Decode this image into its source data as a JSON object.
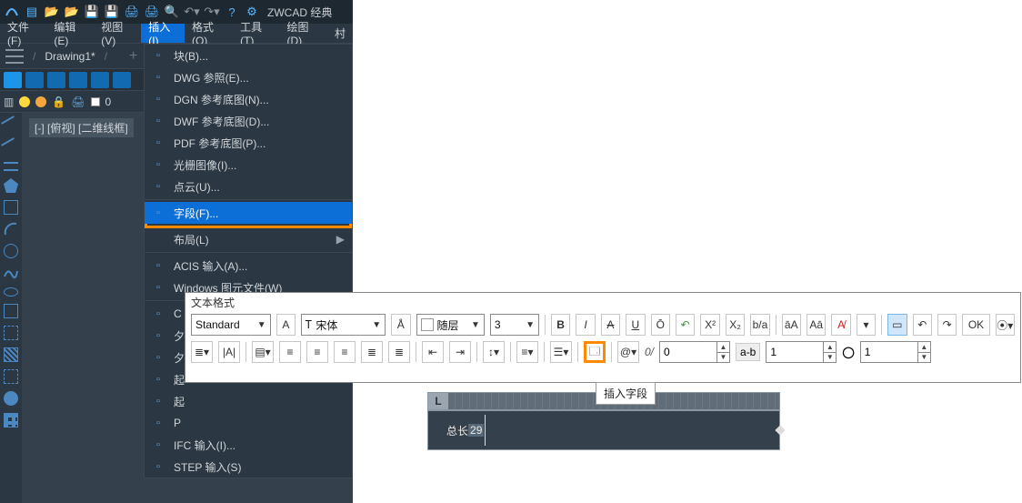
{
  "app_title": "ZWCAD 经典",
  "menubar": {
    "items": [
      "文件(F)",
      "编辑(E)",
      "视图(V)",
      "插入(I)",
      "格式(O)",
      "工具(T)",
      "绘图(D)"
    ],
    "active_index": 3,
    "overflow": "村"
  },
  "document": {
    "tab": "Drawing1*",
    "add_label": "+"
  },
  "viewport_label": "[-] [俯视] [二维线框]",
  "insert_menu": {
    "items": [
      {
        "label": "块(B)...",
        "icon": "block"
      },
      {
        "label": "DWG 参照(E)...",
        "icon": "dwg"
      },
      {
        "label": "DGN 参考底图(N)...",
        "icon": "dgn"
      },
      {
        "label": "DWF 参考底图(D)...",
        "icon": "dwf"
      },
      {
        "label": "PDF 参考底图(P)...",
        "icon": "pdf"
      },
      {
        "label": "光栅图像(I)...",
        "icon": "image"
      },
      {
        "label": "点云(U)...",
        "icon": "cloud"
      },
      {
        "label": "字段(F)...",
        "icon": "field",
        "highlight": true
      },
      {
        "label": "布局(L)",
        "submenu": true,
        "icon": ""
      },
      {
        "label": "ACIS 输入(A)...",
        "icon": "acis"
      },
      {
        "label": "Windows 图元文件(W)",
        "icon": "wmf"
      },
      {
        "label": "C",
        "icon": "obj",
        "truncated": true
      },
      {
        "label": "夕",
        "icon": "ext",
        "truncated": true
      },
      {
        "label": "夕",
        "icon": "ext2",
        "truncated": true
      },
      {
        "label": "起",
        "icon": "hyp",
        "truncated": true
      },
      {
        "label": "起",
        "icon": "map",
        "truncated": true
      },
      {
        "label": "P",
        "icon": "img2",
        "truncated": true
      },
      {
        "label": "IFC 输入(I)...",
        "icon": "ifc",
        "mixed": true
      },
      {
        "label": "STEP 输入(S)",
        "icon": "step"
      }
    ],
    "sep_after": [
      6,
      7,
      8,
      10
    ]
  },
  "mtext": {
    "title": "文本格式",
    "style": {
      "value": "Standard"
    },
    "font": {
      "value": "宋体"
    },
    "annotative_tip": "A",
    "color_label": "随层",
    "size": {
      "value": "3"
    },
    "buttons": {
      "bold": "B",
      "italic": "I",
      "strike": "A",
      "underline": "U",
      "overline": "Ō",
      "undo": "↶",
      "redo": "↷",
      "super": "X²",
      "sub": "X₂",
      "fraction": "b/a",
      "aA": "āA",
      "Aa": "Aā",
      "clear": "A̸",
      "ok": "OK"
    },
    "row2": {
      "oblique_label": "0/",
      "oblique": "0",
      "tracking_label": "a-b",
      "tracking": "1",
      "widthfactor_label": "◯",
      "widthfactor": "1"
    },
    "tooltip": "插入字段",
    "edit_text_plain": "总长",
    "edit_text_sel": "29",
    "ruler_left": "L"
  }
}
